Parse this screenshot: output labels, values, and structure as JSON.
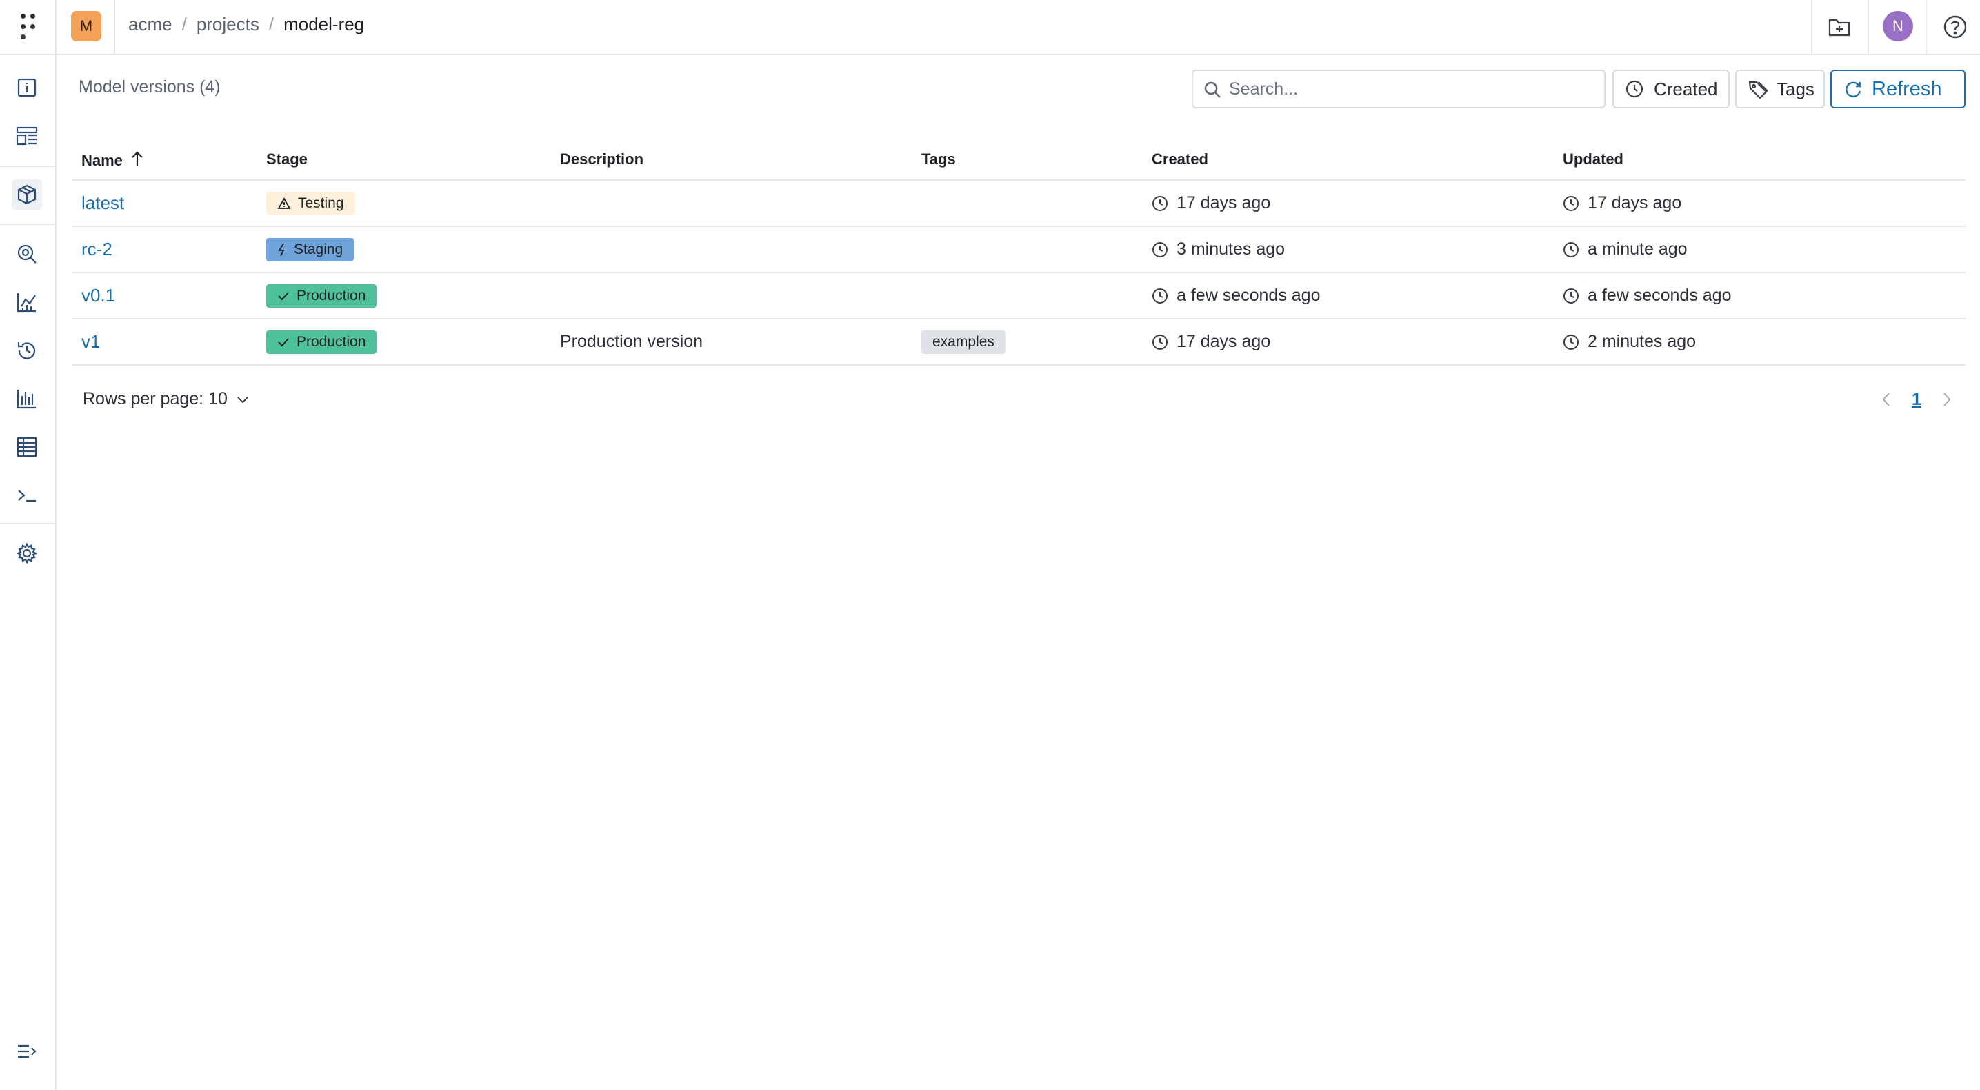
{
  "topbar": {
    "org_initial": "M",
    "breadcrumb": [
      {
        "label": "acme"
      },
      {
        "label": "projects"
      },
      {
        "label": "model-reg"
      }
    ],
    "breadcrumb_separator": "/",
    "user_initial": "N",
    "icons": [
      "app-menu-icon",
      "new-folder-icon",
      "help-icon"
    ],
    "colors": {
      "org_badge": "#f4a259",
      "avatar": "#9a6fc6"
    }
  },
  "sidebar": {
    "items": [
      {
        "name": "info-icon"
      },
      {
        "name": "layout-icon"
      },
      {
        "name": "models-icon",
        "active": true
      },
      {
        "name": "explore-icon"
      },
      {
        "name": "analytics-icon"
      },
      {
        "name": "history-icon"
      },
      {
        "name": "metrics-icon"
      },
      {
        "name": "table-icon"
      },
      {
        "name": "terminal-icon"
      },
      {
        "name": "settings-icon"
      }
    ],
    "collapse_icon": "expand-sidebar-icon"
  },
  "main": {
    "title": "Model versions (4)",
    "search": {
      "placeholder": "Search...",
      "value": ""
    },
    "buttons": {
      "created": "Created",
      "tags": "Tags",
      "refresh": "Refresh"
    },
    "accent_color": "#1a6fb0"
  },
  "table": {
    "columns": {
      "name": "Name",
      "stage": "Stage",
      "description": "Description",
      "tags": "Tags",
      "created": "Created",
      "updated": "Updated"
    },
    "sort": {
      "column": "name",
      "direction": "ascending"
    },
    "rows": [
      {
        "name": "latest",
        "stage": "Testing",
        "stage_type": "testing",
        "stage_icon": "warning-icon",
        "description": "",
        "tags": [],
        "created": "17 days ago",
        "updated": "17 days ago"
      },
      {
        "name": "rc-2",
        "stage": "Staging",
        "stage_type": "staging",
        "stage_icon": "bolt-icon",
        "description": "",
        "tags": [],
        "created": "3 minutes ago",
        "updated": "a minute ago"
      },
      {
        "name": "v0.1",
        "stage": "Production",
        "stage_type": "production",
        "stage_icon": "check-icon",
        "description": "",
        "tags": [],
        "created": "a few seconds ago",
        "updated": "a few seconds ago"
      },
      {
        "name": "v1",
        "stage": "Production",
        "stage_type": "production",
        "stage_icon": "check-icon",
        "description": "Production version",
        "tags": [
          "examples"
        ],
        "created": "17 days ago",
        "updated": "2 minutes ago"
      }
    ],
    "stage_colors": {
      "testing": "#fdf1dc",
      "staging": "#6fa3d9",
      "production": "#4fc19a"
    }
  },
  "pagination": {
    "rows_per_page_label": "Rows per page: 10",
    "current_page": "1"
  }
}
